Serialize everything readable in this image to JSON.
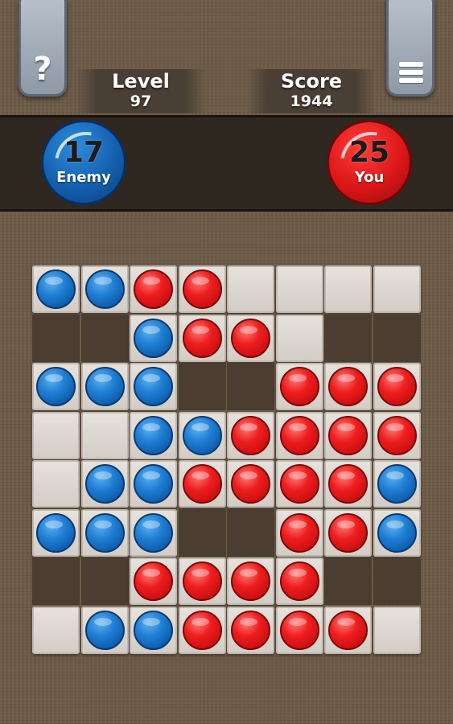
{
  "header": {
    "help_glyph": "?",
    "level_label": "Level",
    "level_value": "97",
    "score_label": "Score",
    "score_value": "1944"
  },
  "players": {
    "enemy": {
      "count": "17",
      "name": "Enemy",
      "color": "#1460b0"
    },
    "you": {
      "count": "25",
      "name": "You",
      "color": "#dc1717"
    }
  },
  "icons": {
    "help": "question-mark-icon",
    "menu": "hamburger-menu-icon"
  },
  "board": {
    "legend": {
      "B": "blue piece",
      "R": "red piece",
      "E": "empty tile",
      "X": "hole"
    },
    "rows": [
      [
        "B",
        "B",
        "R",
        "R",
        "E",
        "E",
        "E",
        "E"
      ],
      [
        "X",
        "X",
        "B",
        "R",
        "R",
        "E",
        "X",
        "X"
      ],
      [
        "B",
        "B",
        "B",
        "X",
        "X",
        "R",
        "R",
        "R"
      ],
      [
        "E",
        "E",
        "B",
        "B",
        "R",
        "R",
        "R",
        "R"
      ],
      [
        "E",
        "B",
        "B",
        "R",
        "R",
        "R",
        "R",
        "B"
      ],
      [
        "B",
        "B",
        "B",
        "X",
        "X",
        "R",
        "R",
        "B"
      ],
      [
        "X",
        "X",
        "R",
        "R",
        "R",
        "R",
        "X",
        "X"
      ],
      [
        "E",
        "B",
        "B",
        "R",
        "R",
        "R",
        "R",
        "E"
      ]
    ]
  }
}
